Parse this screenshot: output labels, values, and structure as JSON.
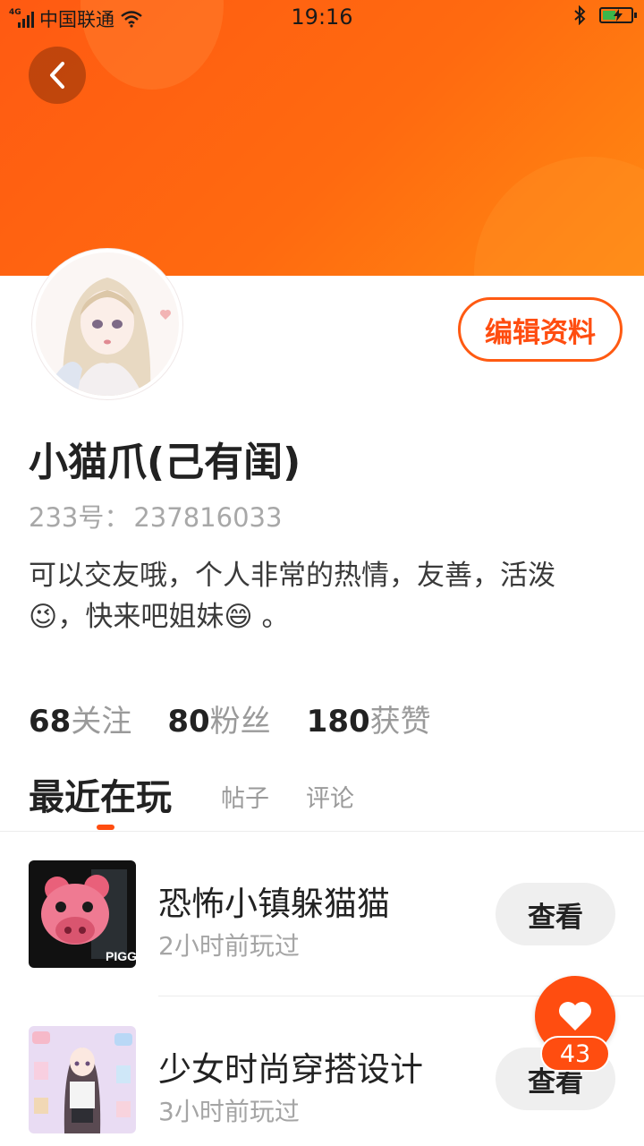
{
  "status_bar": {
    "network_tag": "4G",
    "carrier": "中国联通",
    "time": "19:16",
    "icons": [
      "signal-icon",
      "wifi-icon",
      "bluetooth-icon",
      "battery-charging-icon"
    ]
  },
  "header": {
    "back_icon": "chevron-left-icon",
    "colors": {
      "banner_start": "#ff5a12",
      "banner_end": "#ff8a12"
    }
  },
  "profile": {
    "edit_label": "编辑资料",
    "username": "小猫爪(己有闺)",
    "uid_label": "233号：",
    "uid_value": "237816033",
    "bio": "可以交友哦，个人非常的热情，友善，活泼😉，快来吧姐妹😄 。"
  },
  "stats": [
    {
      "num": "68",
      "label": "关注"
    },
    {
      "num": "80",
      "label": "粉丝"
    },
    {
      "num": "180",
      "label": "获赞"
    }
  ],
  "tabs": {
    "active": "最近在玩",
    "items": [
      "帖子",
      "评论"
    ]
  },
  "games": [
    {
      "title": "恐怖小镇躲猫猫",
      "sub": "2小时前玩过",
      "button": "查看",
      "icon_text": "PIGGY"
    },
    {
      "title": "少女时尚穿搭设计",
      "sub": "3小时前玩过",
      "button": "查看"
    }
  ],
  "like": {
    "count": "43",
    "icon": "heart-icon"
  },
  "accent_color": "#ff4d10"
}
